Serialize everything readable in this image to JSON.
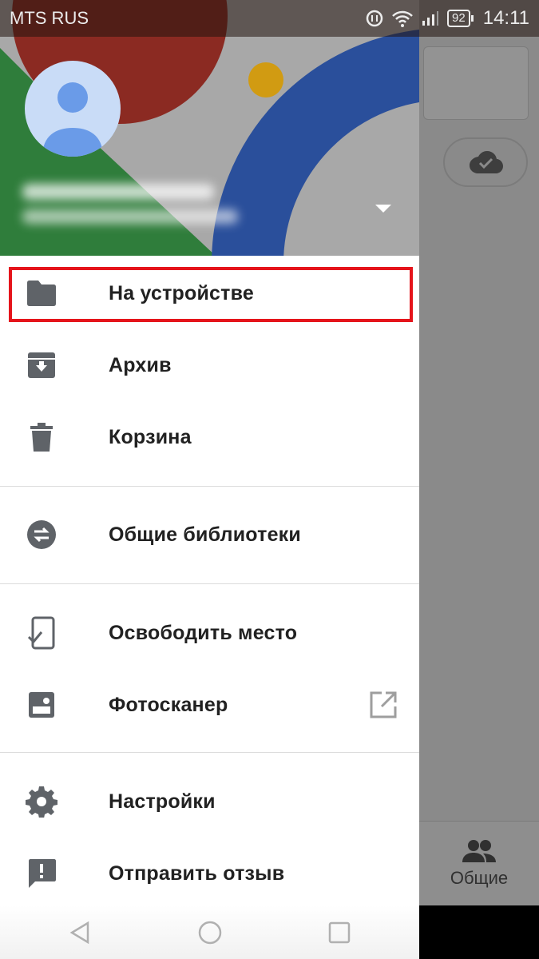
{
  "status_bar": {
    "carrier": "MTS RUS",
    "battery": "92",
    "time": "14:11"
  },
  "drawer": {
    "menu": [
      {
        "label": "На устройстве",
        "icon": "folder-icon"
      },
      {
        "label": "Архив",
        "icon": "archive-icon"
      },
      {
        "label": "Корзина",
        "icon": "trash-icon"
      },
      {
        "label": "Общие библиотеки",
        "icon": "shared-libraries-icon"
      },
      {
        "label": "Освободить место",
        "icon": "free-up-space-icon"
      },
      {
        "label": "Фотосканер",
        "icon": "photoscan-icon",
        "external_icon": "open-external-icon"
      },
      {
        "label": "Настройки",
        "icon": "gear-icon"
      },
      {
        "label": "Отправить отзыв",
        "icon": "feedback-icon"
      }
    ],
    "highlight_color": "#e5141b"
  },
  "background": {
    "bottom_tab_label": "Общие"
  },
  "colors": {
    "header_red": "#8b2a22",
    "header_green": "#2f7d3b",
    "header_blue": "#2a4f9b",
    "header_yellow": "#d19b12",
    "icon_gray": "#5f6368"
  }
}
